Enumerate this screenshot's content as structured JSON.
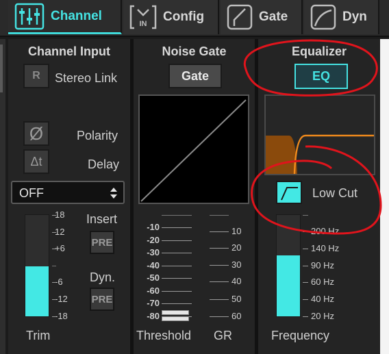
{
  "tabs": [
    {
      "label": "Channel",
      "icon": "channel-sliders-icon",
      "active": true
    },
    {
      "label": "Config",
      "icon": "config-input-icon",
      "active": false
    },
    {
      "label": "Gate",
      "icon": "gate-curve-icon",
      "active": false
    },
    {
      "label": "Dyn",
      "icon": "dyn-curve-icon",
      "active": false
    }
  ],
  "config_icon_text": "IN",
  "channel_input": {
    "title": "Channel Input",
    "stereo_link_button": "R",
    "stereo_link_label": "Stereo Link",
    "polarity_label": "Polarity",
    "delay_label": "Delay",
    "delay_button": "Δt",
    "polarity_button": "Ø",
    "dropdown_value": "OFF",
    "insert_label": "Insert",
    "insert_pre": "PRE",
    "dyn_label": "Dyn.",
    "dyn_pre": "PRE",
    "trim_label": "Trim",
    "trim_scale": [
      "18",
      "12",
      "+6",
      "-6",
      "-12",
      "-18"
    ],
    "trim_level": 0.49
  },
  "noise_gate": {
    "title": "Noise Gate",
    "gate_button": "Gate",
    "threshold_scale": [
      "-10",
      "-20",
      "-30",
      "-40",
      "-50",
      "-60",
      "-70",
      "-80"
    ],
    "gr_scale": [
      "10",
      "20",
      "30",
      "40",
      "50",
      "60"
    ],
    "threshold_label": "Threshold",
    "gr_label": "GR"
  },
  "equalizer": {
    "title": "Equalizer",
    "eq_button": "EQ",
    "low_cut_label": "Low Cut",
    "frequency_scale": [
      "200 Hz",
      "140 Hz",
      "90 Hz",
      "60 Hz",
      "40 Hz",
      "20 Hz"
    ],
    "frequency_label": "Frequency",
    "frequency_level": 0.6
  },
  "colors": {
    "accent": "#45e3e3",
    "meter_fill": "#43e8e4",
    "eq_curve": "#f08a1c",
    "eq_fill": "#8a4a0c",
    "annotation": "#e0141c"
  }
}
